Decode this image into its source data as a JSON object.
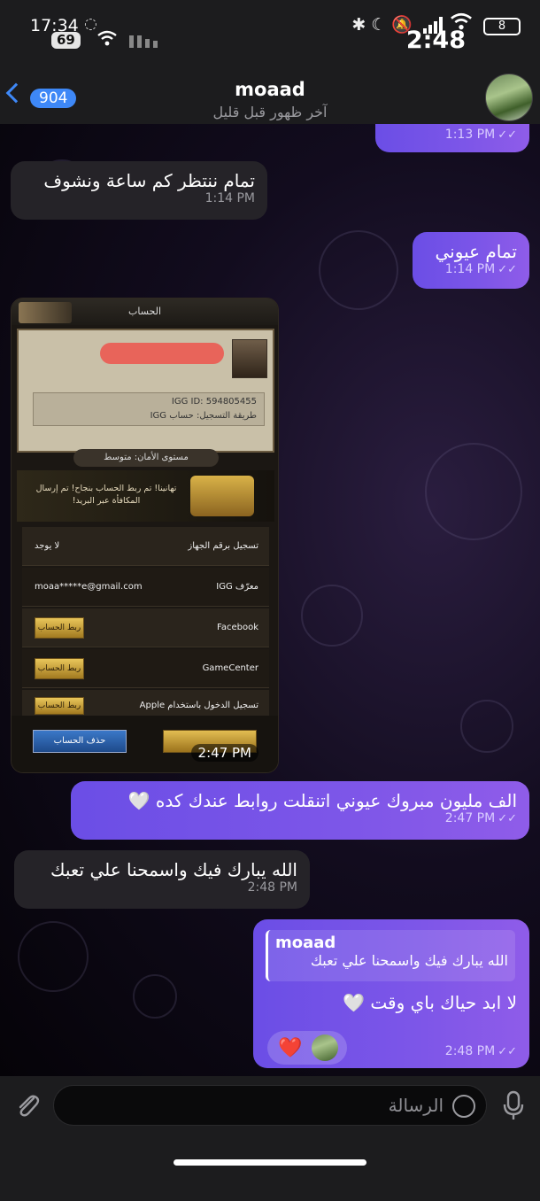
{
  "status_bar": {
    "time": "17:34",
    "badge": "69",
    "clock_overlay": "2:48",
    "battery": "8"
  },
  "header": {
    "back_count": "904",
    "contact_name": "moaad",
    "contact_status": "آخر ظهور قبل قليل"
  },
  "messages": [
    {
      "id": "m1",
      "direction": "out",
      "text": "",
      "time": "1:13 PM",
      "read": true
    },
    {
      "id": "m2",
      "direction": "in",
      "text": "تمام ننتظر كم ساعة ونشوف",
      "time": "1:14 PM"
    },
    {
      "id": "m3",
      "direction": "out",
      "text": "تمام عيوني",
      "time": "1:14 PM",
      "read": true
    },
    {
      "id": "m4",
      "direction": "in",
      "type": "image",
      "time": "2:47 PM"
    },
    {
      "id": "m5",
      "direction": "out",
      "text": "الف مليون مبروك عيوني اتنقلت روابط عندك كده 🤍",
      "time": "2:47 PM",
      "read": true
    },
    {
      "id": "m6",
      "direction": "in",
      "text": "الله يبارك فيك واسمحنا علي تعبك",
      "time": "2:48 PM"
    },
    {
      "id": "m7",
      "direction": "out",
      "reply_name": "moaad",
      "reply_text": "الله يبارك فيك واسمحنا علي تعبك",
      "text": "لا ابد حياك باي وقت 🤍",
      "time": "2:48 PM",
      "read": true,
      "reaction": "❤️"
    }
  ],
  "game_screenshot": {
    "title": "الحساب",
    "igg_id": "IGG ID: 594805455",
    "register_method": "طريقة التسجيل: حساب IGG",
    "security_level": "مستوى الأمان: متوسط",
    "reward_text": "تهانينا! تم ربط الحساب بنجاح! تم إرسال المكافأة عبر البريد!",
    "rows": [
      {
        "label": "تسجيل برقم الجهاز",
        "value": "لا يوجد"
      },
      {
        "label": "معرّف IGG",
        "value": "moaa*****e@gmail.com"
      },
      {
        "label": "Facebook",
        "button": "ربط الحساب"
      },
      {
        "label": "GameCenter",
        "button": "ربط الحساب"
      },
      {
        "label": "تسجيل الدخول باستخدام Apple",
        "button": "ربط الحساب"
      }
    ],
    "delete_label": "حذف الحساب"
  },
  "input": {
    "placeholder": "الرسالة"
  },
  "icons": {
    "back": "chevron-left-icon",
    "attach": "paperclip-icon",
    "sticker": "sticker-icon",
    "mic": "microphone-icon"
  },
  "colors": {
    "accent": "#3e88f7",
    "outgoing_bubble": "#7d56e8",
    "incoming_bubble": "#252328"
  }
}
